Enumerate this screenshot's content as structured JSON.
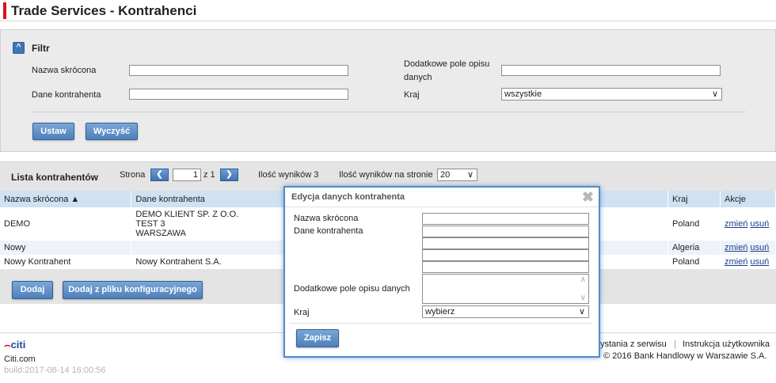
{
  "header": {
    "title": "Trade Services - Kontrahenci"
  },
  "filter": {
    "title": "Filtr",
    "labels": {
      "nazwa": "Nazwa skrócona",
      "dane": "Dane kontrahenta",
      "dodatkowe_line1": "Dodatkowe pole opisu",
      "dodatkowe_line2": "danych",
      "kraj": "Kraj"
    },
    "kraj_value": "wszystkie",
    "buttons": {
      "ustaw": "Ustaw",
      "wyczysc": "Wyczyść"
    }
  },
  "list": {
    "title": "Lista kontrahentów",
    "strona_label": "Strona",
    "page_value": "1",
    "page_of": "z 1",
    "results": "Ilość wyników 3",
    "per_page_label": "Ilość wyników na stronie",
    "per_page_value": "20",
    "columns": {
      "nazwa": "Nazwa skrócona ▲",
      "dane": "Dane kontrahenta",
      "kraj": "Kraj",
      "akcje": "Akcje"
    },
    "rows": [
      {
        "nazwa": "DEMO",
        "dane_l1": "DEMO KLIENT SP. Z O.O.",
        "dane_l2": "TEST 3",
        "dane_l3": "WARSZAWA",
        "kraj": "Poland",
        "edit": "zmień",
        "delete": "usuń"
      },
      {
        "nazwa": "Nowy",
        "dane_l1": "",
        "kraj": "Algeria",
        "edit": "zmień",
        "delete": "usuń"
      },
      {
        "nazwa": "Nowy Kontrahent",
        "dane_l1": "Nowy Kontrahent S.A.",
        "kraj": "Poland",
        "edit": "zmień",
        "delete": "usuń"
      }
    ],
    "buttons": {
      "dodaj": "Dodaj",
      "dodaj_plik": "Dodaj z pliku konfiguracyjnego"
    }
  },
  "footer": {
    "logo": "citi",
    "site": "Citi.com",
    "build": "build:2017-08-14 16:00:56",
    "link1": "ystania z serwisu",
    "separator": "|",
    "link2": "Instrukcja użytkownika",
    "copyright": "© 2016 Bank Handlowy w Warszawie S.A."
  },
  "modal": {
    "title": "Edycja danych kontrahenta",
    "labels": {
      "nazwa": "Nazwa skrócona",
      "dane": "Dane kontrahenta",
      "dodatkowe": "Dodatkowe pole opisu danych",
      "kraj": "Kraj"
    },
    "kraj_value": "wybierz",
    "save": "Zapisz"
  },
  "colors": {
    "accent": "#d8121a",
    "button": "#4f80bb",
    "table_header": "#cfe1f3",
    "modal_border": "#4f8ccc"
  }
}
